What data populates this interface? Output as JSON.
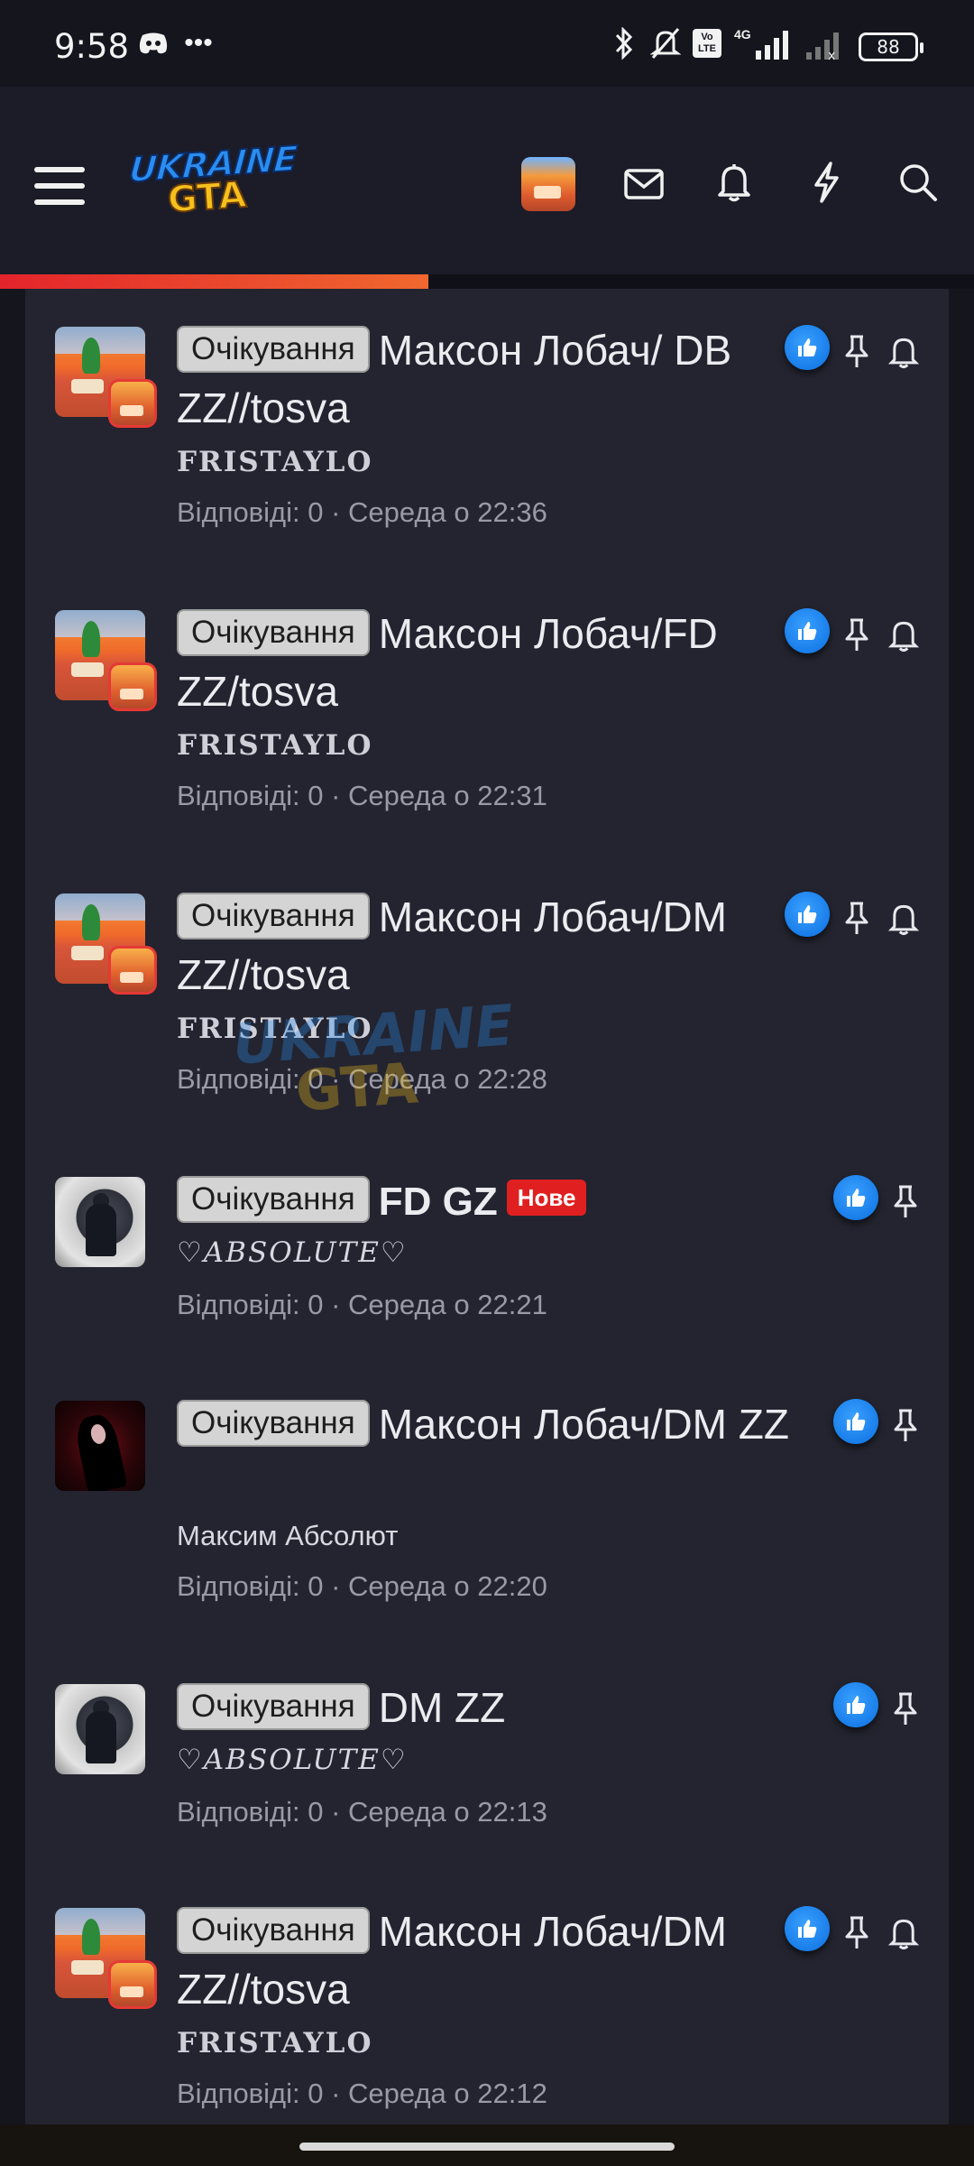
{
  "status_bar": {
    "time": "9:58",
    "icons": [
      "discord-icon",
      "more-dots-icon",
      "bluetooth-icon",
      "mute-icon",
      "volte-icon",
      "signal-4g-icon",
      "signal-nosim-icon"
    ],
    "network_label": "4G",
    "volte_label": "Vo LTE",
    "battery": "88"
  },
  "header": {
    "logo_line1": "UKRAINE",
    "logo_line2": "GTA",
    "icons": [
      "menu-icon",
      "avatar",
      "mail-icon",
      "bell-icon",
      "bolt-icon",
      "search-icon"
    ],
    "progress_percent": 44,
    "accent": "#e3242b"
  },
  "watermark": {
    "line1": "UKRAINE",
    "line2": "GTA"
  },
  "threads": [
    {
      "badge": "Очікування",
      "title": "Максон Лобач/ DB ZZ//tosva",
      "author": "FRISTAYLO",
      "meta": "Відповіді: 0 · Середа о 22:36"
    },
    {
      "badge": "Очікування",
      "title": "Максон Лобач/FD ZZ/tosva",
      "author": "FRISTAYLO",
      "meta": "Відповіді: 0 · Середа о 22:31"
    },
    {
      "badge": "Очікування",
      "title": "Максон Лобач/DM ZZ//tosva",
      "author": "FRISTAYLO",
      "meta": "Відповіді: 0 · Середа о 22:28"
    },
    {
      "badge": "Очікування",
      "title": "FD GZ",
      "new_label": "Нове",
      "author": "♡ABSOLUTE♡",
      "meta": "Відповіді: 0 · Середа о 22:21"
    },
    {
      "badge": "Очікування",
      "title": "Максон Лобач/DM ZZ",
      "author": "Максим Абсолют",
      "meta": "Відповіді: 0 · Середа о 22:20"
    },
    {
      "badge": "Очікування",
      "title": "DM ZZ",
      "author": "♡ABSOLUTE♡",
      "meta": "Відповіді: 0 · Середа о 22:13"
    },
    {
      "badge": "Очікування",
      "title": "Максон Лобач/DM ZZ//tosva",
      "author": "FRISTAYLO",
      "meta": "Відповіді: 0 · Середа о 22:12"
    }
  ]
}
